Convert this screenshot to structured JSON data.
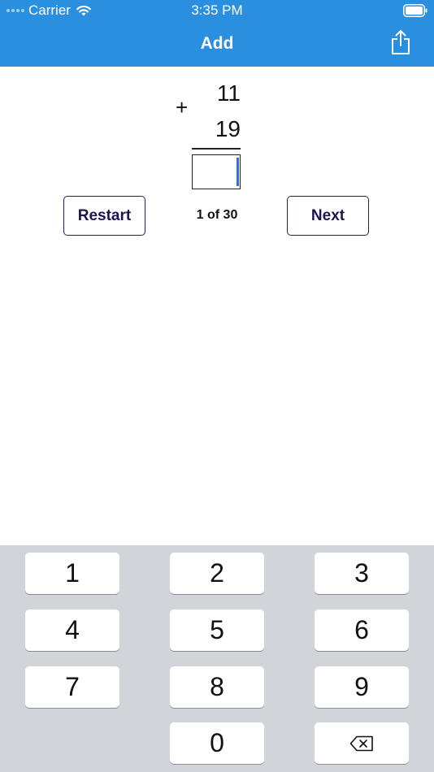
{
  "status_bar": {
    "carrier": "Carrier",
    "time": "3:35 PM"
  },
  "nav": {
    "title": "Add",
    "share_icon": "share-icon"
  },
  "problem": {
    "operator": "+",
    "addend_top": "11",
    "addend_bottom": "19",
    "answer": ""
  },
  "controls": {
    "restart_label": "Restart",
    "next_label": "Next",
    "progress_text": "1 of 30"
  },
  "keypad": {
    "keys": [
      "1",
      "2",
      "3",
      "4",
      "5",
      "6",
      "7",
      "8",
      "9",
      "0"
    ],
    "backspace_icon": "backspace-icon"
  },
  "colors": {
    "nav_background": "#2b8fe0",
    "button_border": "#2a1a5e",
    "keypad_background": "#d1d4d9"
  }
}
